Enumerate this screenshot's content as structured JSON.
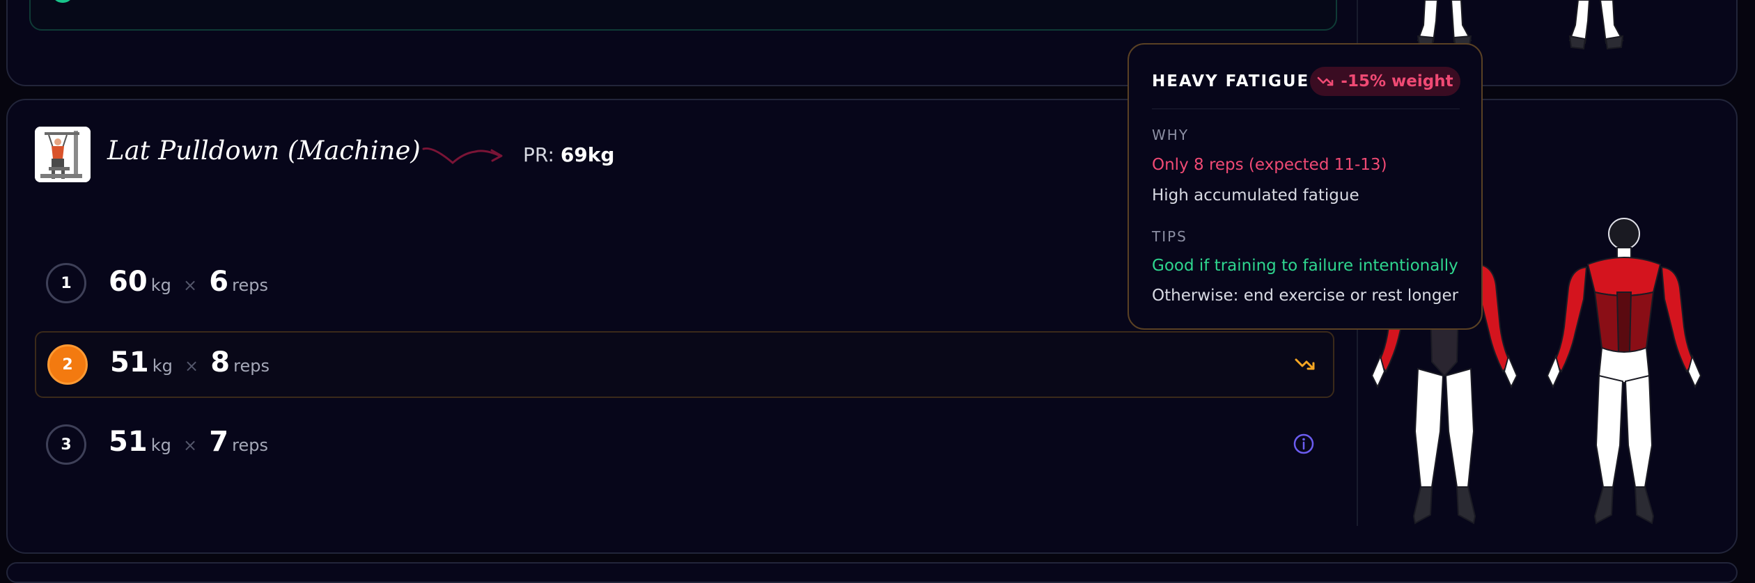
{
  "exercise": {
    "title": "Lat Pulldown (Machine)",
    "pr_label": "PR:",
    "pr_value": "69kg"
  },
  "sets": [
    {
      "number": "1",
      "weight": "60",
      "weight_unit": "kg",
      "times": "×",
      "reps": "6",
      "reps_unit": "reps",
      "status_icon": ""
    },
    {
      "number": "2",
      "weight": "51",
      "weight_unit": "kg",
      "times": "×",
      "reps": "8",
      "reps_unit": "reps",
      "status_icon": "trend-down-icon"
    },
    {
      "number": "3",
      "weight": "51",
      "weight_unit": "kg",
      "times": "×",
      "reps": "7",
      "reps_unit": "reps",
      "status_icon": "info-icon"
    }
  ],
  "tooltip": {
    "title": "HEAVY FATIGUE",
    "badge": "-15% weight",
    "why_label": "WHY",
    "why_items": [
      "Only 8 reps (expected 11-13)",
      "High accumulated fatigue"
    ],
    "tips_label": "TIPS",
    "tips_items": [
      "Good if training to failure intentionally",
      "Otherwise: end exercise or rest longer"
    ]
  },
  "colors": {
    "accent_orange": "#f37a10",
    "fatigue_red": "#f04a74",
    "tip_green": "#2fd68f",
    "info_purple": "#6b5cf0",
    "warning_yellow": "#f5a623",
    "muscle_highlight": "#d4141e"
  },
  "icons": {
    "exercise_thumbnail": "lat-pulldown-thumbnail",
    "trend": "trend-down-arrow-icon",
    "body_map": "muscle-map-front-back"
  }
}
